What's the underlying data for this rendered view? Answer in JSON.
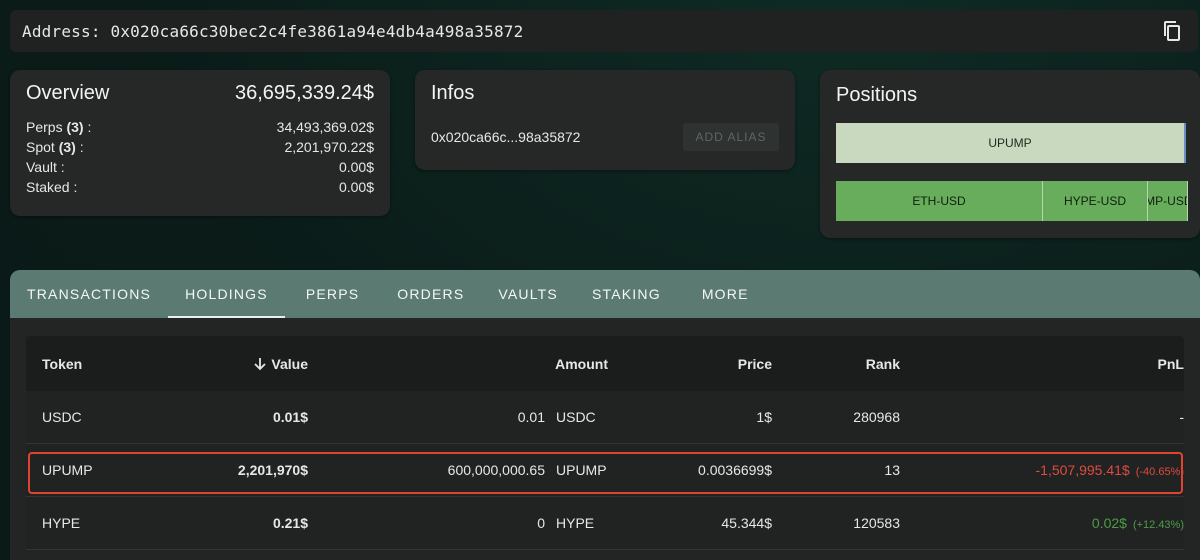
{
  "address": {
    "label": "Address: 0x020ca66c30bec2c4fe3861a94e4db4a498a35872"
  },
  "overview": {
    "title": "Overview",
    "total": "36,695,339.24$",
    "rows": [
      {
        "label": "Perps ",
        "count": "(3)",
        "suffix": " :",
        "value": "34,493,369.02$"
      },
      {
        "label": "Spot ",
        "count": "(3)",
        "suffix": " :",
        "value": "2,201,970.22$"
      },
      {
        "label": "Vault :",
        "count": "",
        "suffix": "",
        "value": "0.00$"
      },
      {
        "label": "Staked :",
        "count": "",
        "suffix": "",
        "value": "0.00$"
      }
    ]
  },
  "infos": {
    "title": "Infos",
    "short_address": "0x020ca66c...98a35872",
    "alias_button": "ADD ALIAS"
  },
  "positions": {
    "title": "Positions",
    "spot": "UPUMP",
    "perps": [
      "ETH-USD",
      "HYPE-USD",
      "PUMP-USD"
    ]
  },
  "tabs": [
    "TRANSACTIONS",
    "HOLDINGS",
    "PERPS",
    "ORDERS",
    "VAULTS",
    "STAKING",
    "MORE"
  ],
  "active_tab": "HOLDINGS",
  "table": {
    "headers": {
      "token": "Token",
      "value": "Value",
      "amount": "Amount",
      "price": "Price",
      "rank": "Rank",
      "pnl": "PnL"
    },
    "rows": [
      {
        "token": "USDC",
        "value": "0.01$",
        "amount": "0.01",
        "amount_token": "USDC",
        "price": "1$",
        "rank": "280968",
        "pnl": "-",
        "pnl_pct": ""
      },
      {
        "token": "UPUMP",
        "value": "2,201,970$",
        "amount": "600,000,000.65",
        "amount_token": "UPUMP",
        "price": "0.0036699$",
        "rank": "13",
        "pnl": "-1,507,995.41$",
        "pnl_pct": "(-40.65%)"
      },
      {
        "token": "HYPE",
        "value": "0.21$",
        "amount": "0",
        "amount_token": "HYPE",
        "price": "45.344$",
        "rank": "120583",
        "pnl": "0.02$",
        "pnl_pct": "(+12.43%)"
      }
    ]
  },
  "colors": {
    "negative": "#e04a3f",
    "positive": "#4f9a47",
    "tabbar": "#5b7b72",
    "highlight": "#e0432f"
  }
}
